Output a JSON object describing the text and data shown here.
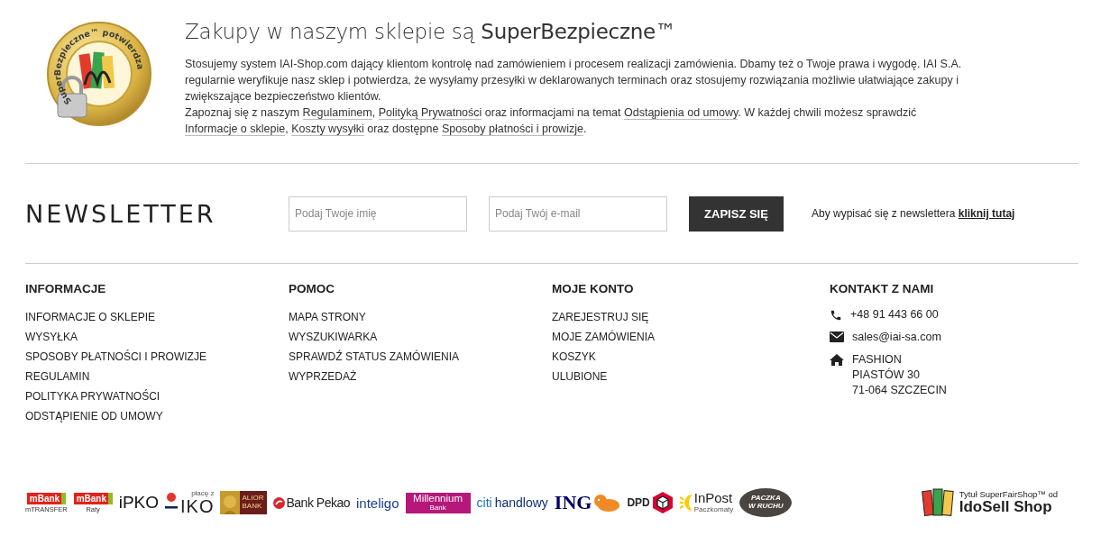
{
  "security": {
    "seal_text": "SuperBezpieczne™ potwierdza",
    "title": "Zakupy w naszym sklepie są **SuperBezpieczne™**",
    "paragraph": "Stosujemy system IAI-Shop.com dający klientom kontrolę nad zamówieniem i procesem realizacji zamówienia. Dbamy też o Twoje prawa i wygodę. IAI S.A. regularnie weryfikuje nasz sklep i potwierdza, że wysyłamy przesyłki w deklarowanych terminach oraz stosujemy rozwiązania możliwie ułatwiające zakupy i zwiększające bezpieczeństwo klientów.",
    "links_paragraph": [
      {
        "text": "Zapoznaj się z naszym ",
        "link": false
      },
      {
        "text": "Regulaminem",
        "link": true
      },
      {
        "text": ", ",
        "link": false
      },
      {
        "text": "Polityką Prywatności",
        "link": true
      },
      {
        "text": " oraz informacjami na temat ",
        "link": false
      },
      {
        "text": "Odstąpienia od umowy",
        "link": true
      },
      {
        "text": ". W każdej chwili możesz sprawdzić ",
        "link": false
      },
      {
        "text": "Informacje o sklepie",
        "link": true
      },
      {
        "text": ", ",
        "link": false
      },
      {
        "text": "Koszty wysyłki",
        "link": true
      },
      {
        "text": " oraz dostępne ",
        "link": false
      },
      {
        "text": "Sposoby płatności i prowizje",
        "link": true
      },
      {
        "text": ".",
        "link": false
      }
    ]
  },
  "newsletter": {
    "title": "NEWSLETTER",
    "name_field": {
      "placeholder": "Podaj Twoje imię"
    },
    "email_field": {
      "placeholder": "Podaj Twój e-mail"
    },
    "button": "ZAPISZ SIĘ",
    "unsubscribe_text": "Aby wypisać się z newslettera ",
    "unsubscribe_link": "kliknij tutaj"
  },
  "footer_columns": [
    {
      "heading": "INFORMACJE",
      "items": [
        "INFORMACJE O SKLEPIE",
        "WYSYŁKA",
        "SPOSOBY PŁATNOŚCI I PROWIZJE",
        "REGULAMIN",
        "POLITYKA PRYWATNOŚCI",
        "ODSTĄPIENIE OD UMOWY"
      ]
    },
    {
      "heading": "POMOC",
      "items": [
        "MAPA STRONY",
        "WYSZUKIWARKA",
        "SPRAWDŹ STATUS ZAMÓWIENIA",
        "WYPRZEDAŻ"
      ]
    },
    {
      "heading": "MOJE KONTO",
      "items": [
        "ZAREJESTRUJ SIĘ",
        "MOJE ZAMÓWIENIA",
        "KOSZYK",
        "ULUBIONE"
      ]
    }
  ],
  "contact": {
    "heading": "KONTAKT Z NAMI",
    "entries": [
      {
        "kind": "phone",
        "lines": [
          "+48 91 443 66 00"
        ]
      },
      {
        "kind": "email",
        "lines": [
          "sales@iai-sa.com"
        ]
      },
      {
        "kind": "address",
        "lines": [
          "FASHION",
          "PIASTÓW 30",
          "71-064 SZCZECIN"
        ]
      }
    ]
  },
  "payment_logos": [
    {
      "kind": "mbank",
      "texts": [
        "mBank",
        "mTRANSFER"
      ]
    },
    {
      "kind": "mbank",
      "texts": [
        "mBank",
        "Raty"
      ]
    },
    {
      "kind": "ipko",
      "texts": [
        "iPKO"
      ]
    },
    {
      "kind": "iko",
      "texts": [
        "płacę z",
        "IKO"
      ]
    },
    {
      "kind": "alior",
      "texts": [
        "ALIOR",
        "BANK"
      ]
    },
    {
      "kind": "pekao",
      "texts": [
        "Bank Pekao"
      ]
    },
    {
      "kind": "inteligo",
      "texts": [
        "inteligo"
      ]
    },
    {
      "kind": "millennium",
      "texts": [
        "Millennium",
        "Bank"
      ]
    },
    {
      "kind": "citi",
      "texts": [
        "citi",
        "handlowy"
      ]
    },
    {
      "kind": "ing",
      "texts": [
        "ING"
      ]
    },
    {
      "kind": "dpd",
      "texts": [
        "DPD"
      ]
    },
    {
      "kind": "inpost",
      "texts": [
        "InPost",
        "Paczkomaty"
      ]
    },
    {
      "kind": "ruch",
      "texts": [
        "PACZKA",
        "W RUCHU"
      ]
    }
  ],
  "shop_badge": {
    "line_1": "Tytuł SuperFairShop™ od",
    "line_2": "IdoSell Shop"
  }
}
